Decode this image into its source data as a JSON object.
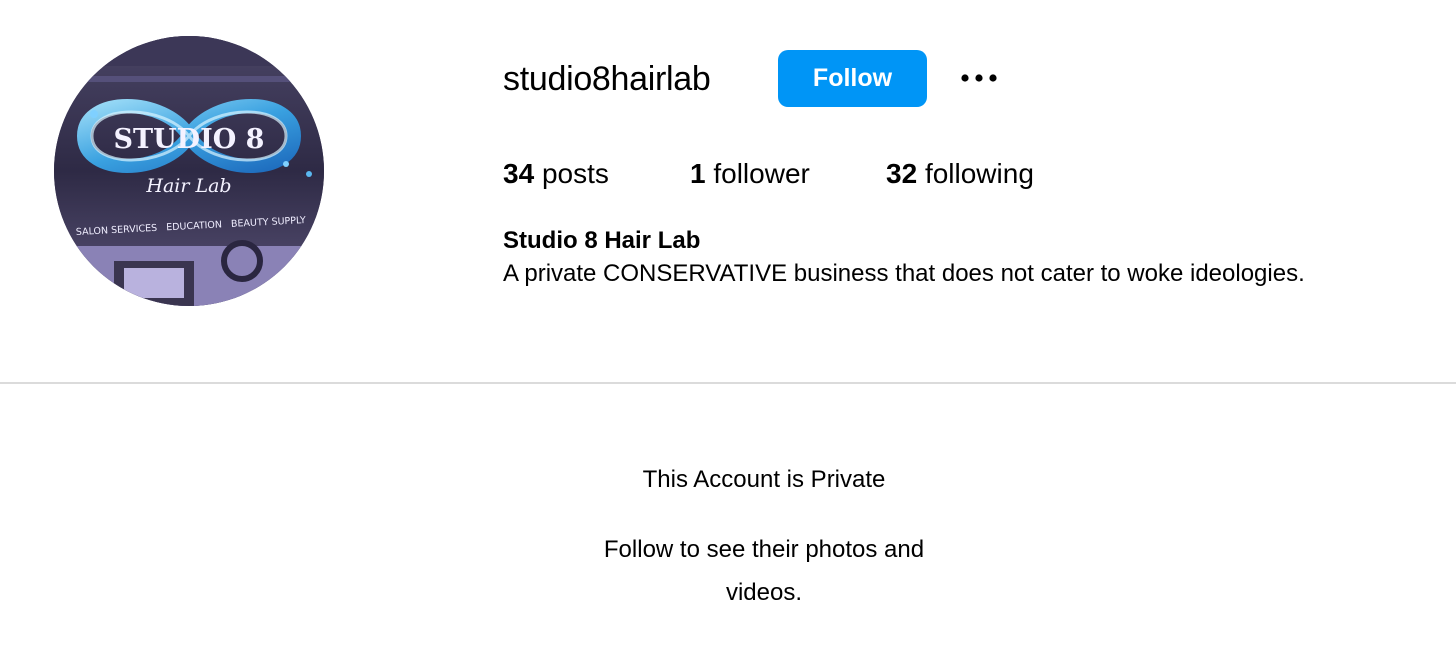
{
  "profile": {
    "username": "studio8hairlab",
    "follow_label": "Follow",
    "more_icon": "more-horizontal-icon",
    "full_name": "Studio 8 Hair Lab",
    "bio": "A private CONSERVATIVE business that does not cater to woke ideologies.",
    "accent_color": "#0095f6"
  },
  "avatar": {
    "logo_title": "STUDIO 8",
    "logo_script": "Hair Lab",
    "logo_tagline": "SALON SERVICES   EDUCATION   BEAUTY SUPPLY"
  },
  "stats": {
    "posts": {
      "count": "34",
      "label": "posts"
    },
    "followers": {
      "count": "1",
      "label": "follower"
    },
    "following": {
      "count": "32",
      "label": "following"
    }
  },
  "private_notice": {
    "title": "This Account is Private",
    "subtitle_line1": "Follow to see their photos and",
    "subtitle_line2": "videos."
  }
}
